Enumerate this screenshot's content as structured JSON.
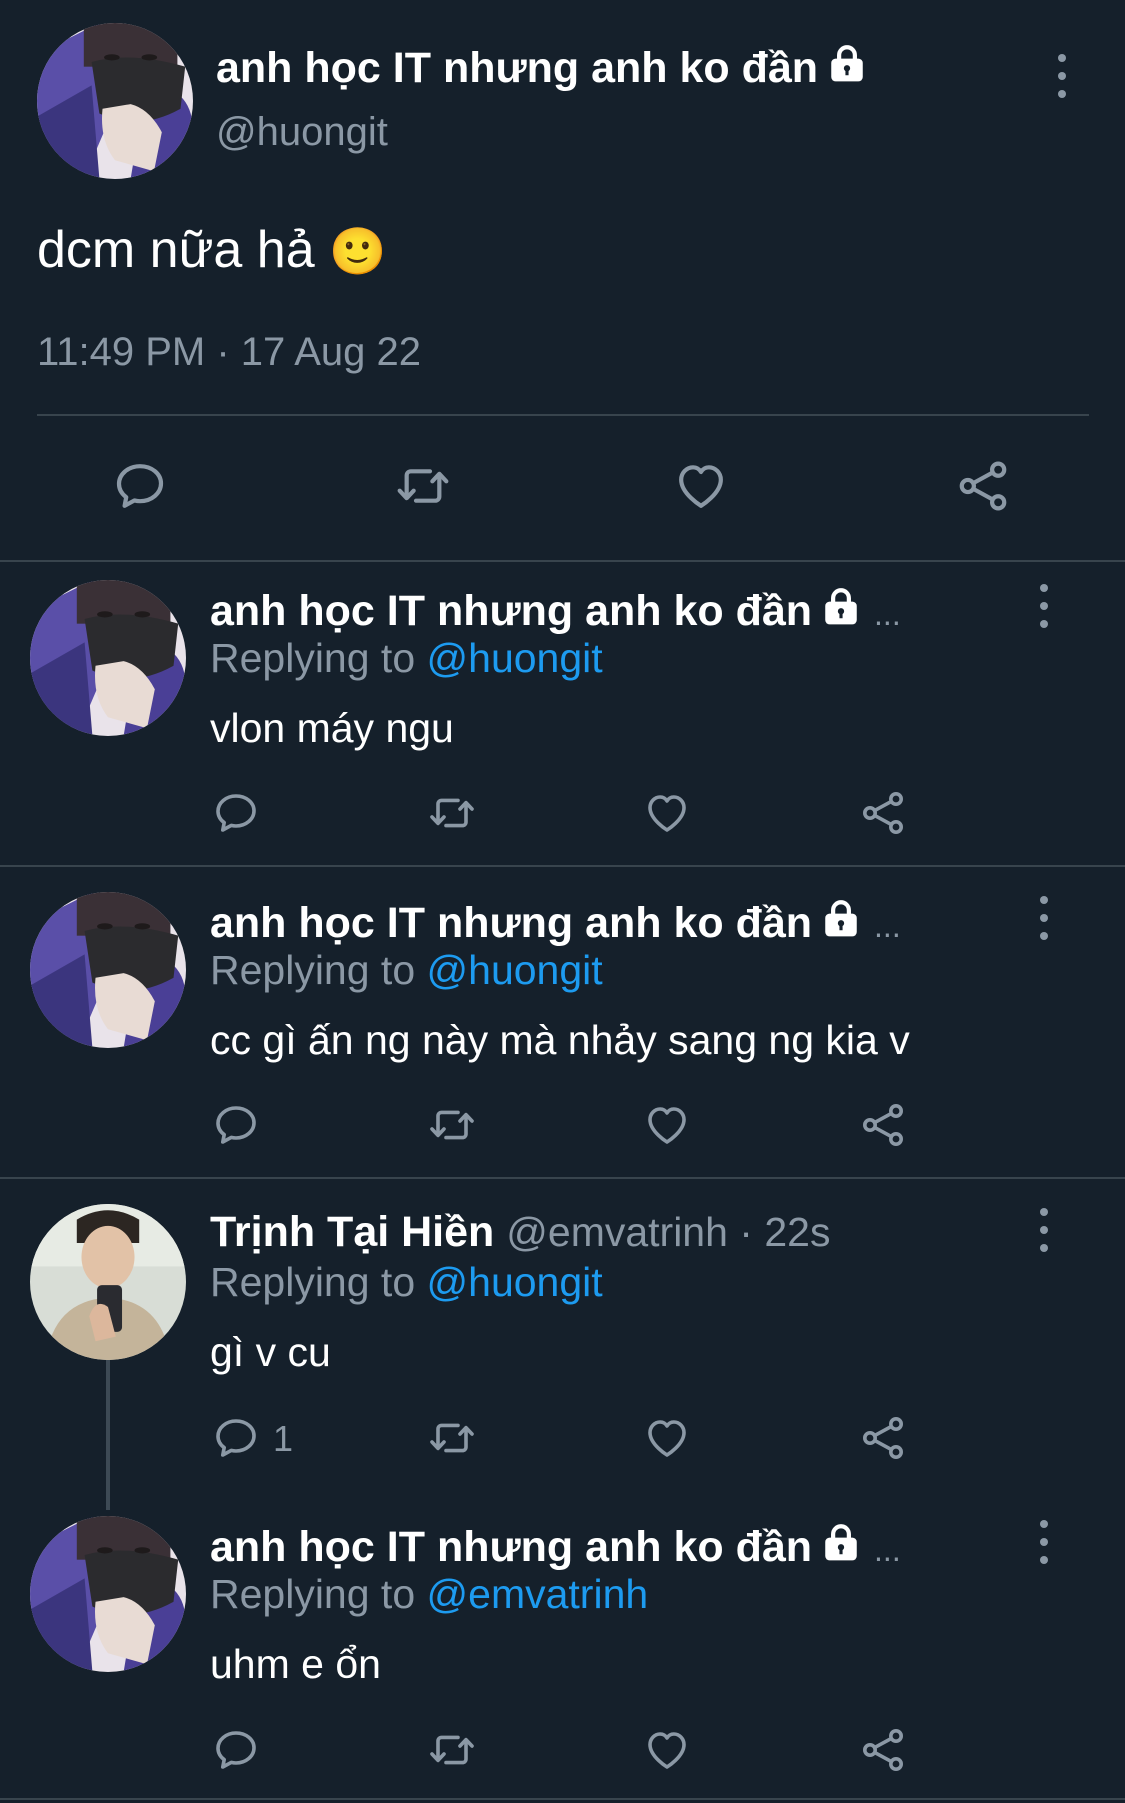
{
  "main_tweet": {
    "display_name": "anh học IT nhưng anh ko đần",
    "handle": "@huongit",
    "text": "dcm nữa hả",
    "emoji": "🙂",
    "timestamp": "11:49 PM · 17 Aug 22"
  },
  "replies": [
    {
      "display_name": "anh học IT nhưng anh ko đần",
      "ellipsis": "...",
      "replying_prefix": "Replying to",
      "replying_to": "@huongit",
      "text": "vlon máy ngu"
    },
    {
      "display_name": "anh học IT nhưng anh ko đần",
      "ellipsis": "...",
      "replying_prefix": "Replying to",
      "replying_to": "@huongit",
      "text": "cc gì ấn ng này mà nhảy sang ng kia v"
    },
    {
      "display_name": "Trịnh Tại Hiền",
      "handle_time": "@emvatrinh · 22s",
      "replying_prefix": "Replying to",
      "replying_to": "@huongit",
      "text": "gì v cu",
      "reply_count": "1"
    },
    {
      "display_name": "anh học IT nhưng anh ko đần",
      "ellipsis": "...",
      "replying_prefix": "Replying to",
      "replying_to": "@emvatrinh",
      "text": "uhm e ổn"
    }
  ],
  "icons": {
    "reply": "reply-icon",
    "retweet": "retweet-icon",
    "like": "heart-icon",
    "share": "share-icon",
    "more": "kebab-icon",
    "protected": "lock-icon"
  },
  "colors": {
    "background": "#15202b",
    "text": "#ffffff",
    "secondary": "#8b98a5",
    "link": "#1d9bf0",
    "divider": "#38444d"
  }
}
